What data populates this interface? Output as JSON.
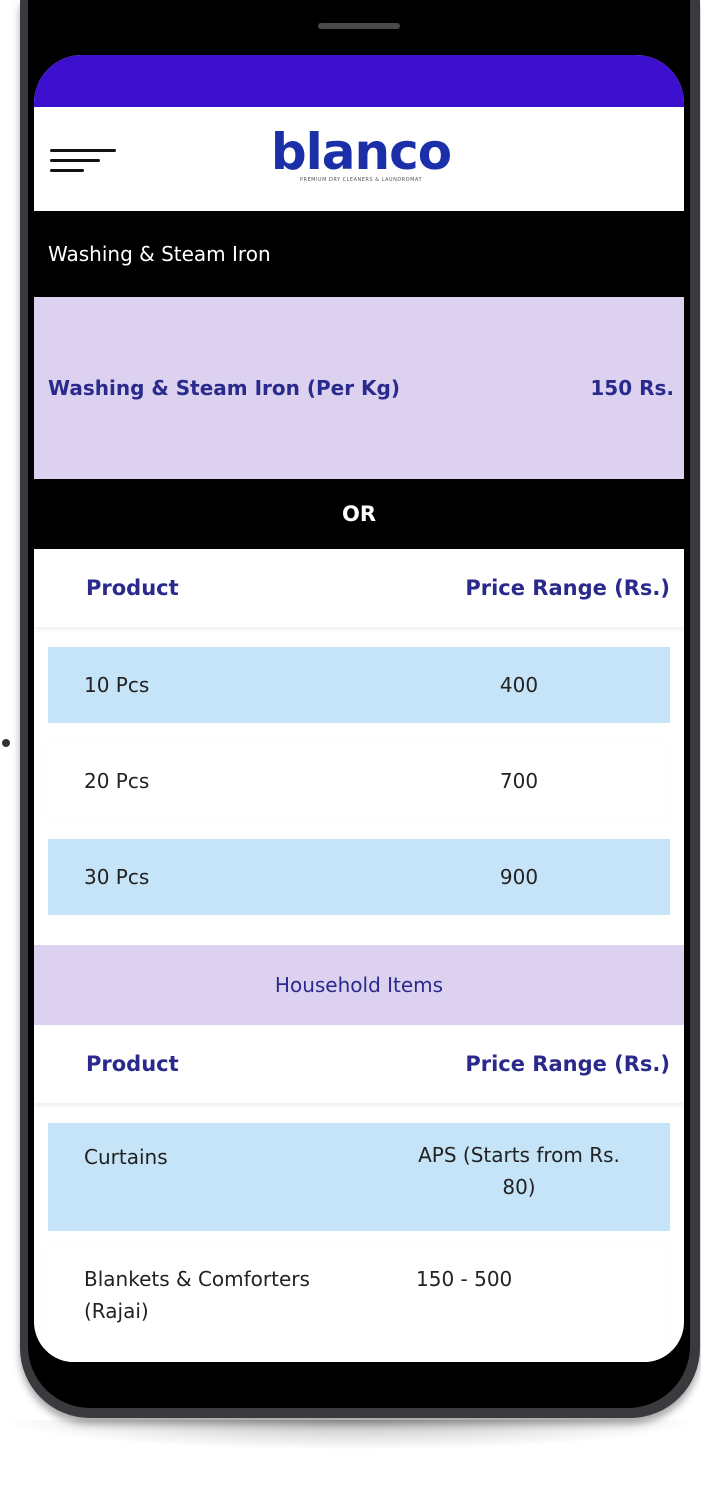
{
  "header": {
    "logo_text": "blanco",
    "logo_tagline": "PREMIUM DRY CLEANERS & LAUNDROMAT"
  },
  "section_title": "Washing & Steam Iron",
  "per_kg": {
    "label": "Washing & Steam Iron (Per Kg)",
    "price": "150 Rs."
  },
  "or_label": "OR",
  "pieces_table": {
    "headers": {
      "product": "Product",
      "price": "Price Range (Rs.)"
    },
    "rows": [
      {
        "product": "10 Pcs",
        "price": "400"
      },
      {
        "product": "20 Pcs",
        "price": "700"
      },
      {
        "product": "30 Pcs",
        "price": "900"
      }
    ]
  },
  "household": {
    "title": "Household Items",
    "headers": {
      "product": "Product",
      "price": "Price Range (Rs.)"
    },
    "rows": [
      {
        "product": "Curtains",
        "price": "APS (Starts from Rs. 80)"
      },
      {
        "product": "Blankets & Comforters (Rajai)",
        "price": "150 - 500"
      }
    ]
  },
  "colors": {
    "status_bar": "#3d0fcf",
    "accent_text": "#2a2a8c",
    "lavender": "#dcd2f0",
    "light_blue": "#c5e4f8"
  }
}
